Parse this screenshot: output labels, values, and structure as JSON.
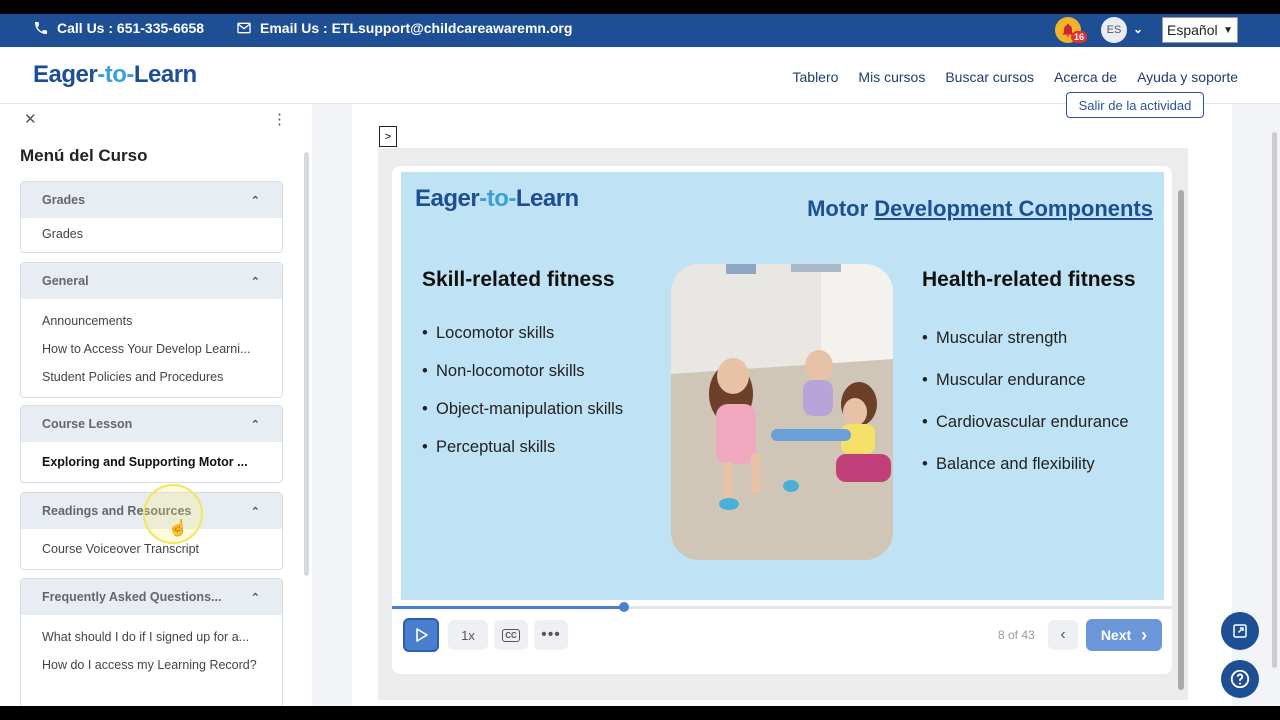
{
  "topbar": {
    "phone": "Call Us : 651-335-6658",
    "email": "Email Us : ETLsupport@childcareawaremn.org",
    "notification_count": "16",
    "avatar_initials": "ES",
    "language": "Español"
  },
  "header": {
    "logo": {
      "part1": "Eager",
      "part2": "-to-",
      "part3": "Learn"
    },
    "nav": [
      "Tablero",
      "Mis cursos",
      "Buscar cursos",
      "Acerca de",
      "Ayuda y soporte"
    ]
  },
  "sidebar": {
    "title": "Menú del Curso",
    "sections": [
      {
        "title": "Grades",
        "items": [
          "Grades"
        ]
      },
      {
        "title": "General",
        "items": [
          "Announcements",
          "How to Access Your Develop Learni...",
          "Student Policies and Procedures"
        ]
      },
      {
        "title": "Course Lesson",
        "items": [
          "Exploring and Supporting Motor ..."
        ]
      },
      {
        "title": "Readings and Resources",
        "items": [
          "Course Voiceover Transcript"
        ]
      },
      {
        "title": "Frequently Asked Questions...",
        "items": [
          "What should I do if I signed up for a...",
          "How do I access my Learning Record?"
        ]
      }
    ]
  },
  "main": {
    "exit_label": "Salir de la actividad",
    "toggle_label": ">"
  },
  "slide": {
    "logo": {
      "part1": "Eager",
      "part2": "-to-",
      "part3": "Learn"
    },
    "title_plain": "Motor ",
    "title_underlined": "Development Components",
    "left_heading": "Skill-related fitness",
    "left_items": [
      "Locomotor skills",
      "Non-locomotor skills",
      "Object-manipulation skills",
      "Perceptual skills"
    ],
    "right_heading": "Health-related fitness",
    "right_items": [
      "Muscular strength",
      "Muscular endurance",
      "Cardiovascular endurance",
      "Balance and flexibility"
    ]
  },
  "player": {
    "progress": 0.297,
    "speed": "1x",
    "slide_counter": "8 of 43",
    "next_label": "Next"
  },
  "colors": {
    "brand_blue": "#1e4f94",
    "accent_blue": "#4a7fd0",
    "slide_bg": "#bfe3f4"
  }
}
